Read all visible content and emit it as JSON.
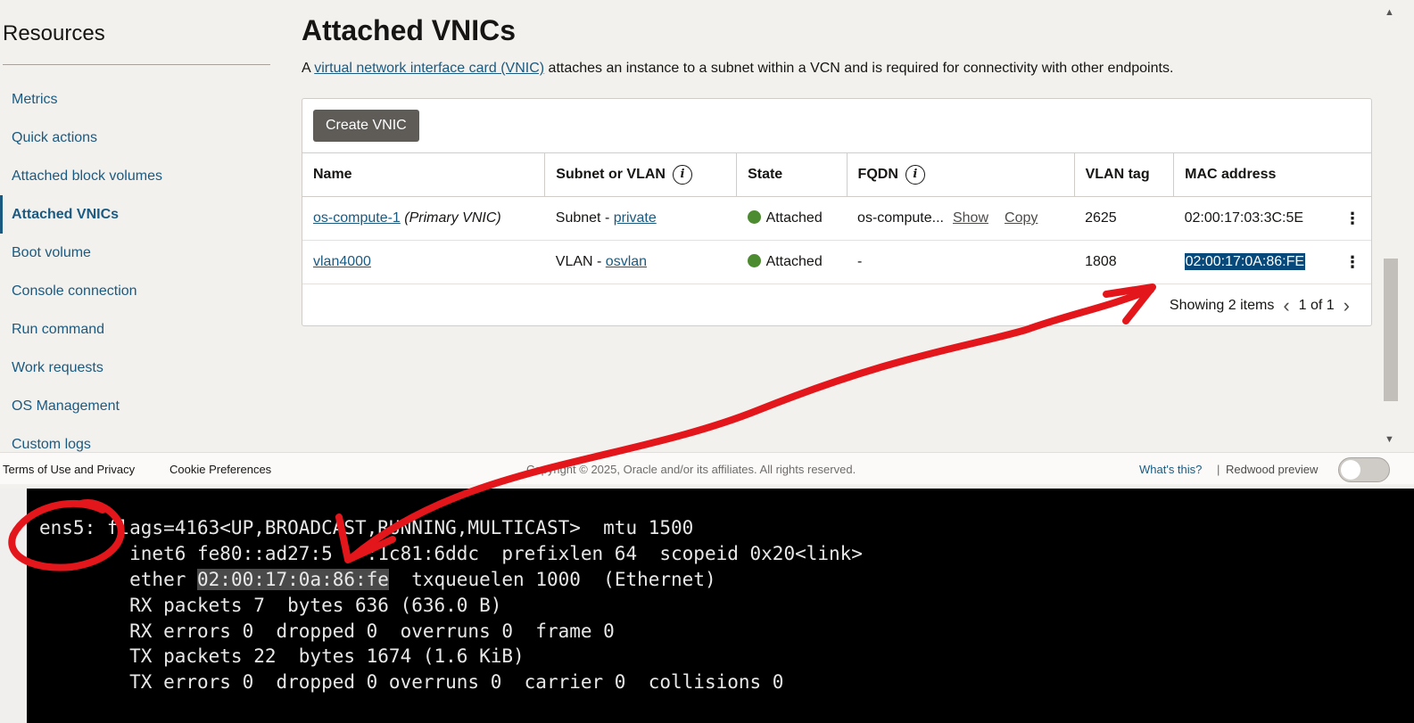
{
  "sidebar": {
    "title": "Resources",
    "items": [
      {
        "label": "Metrics",
        "active": false
      },
      {
        "label": "Quick actions",
        "active": false
      },
      {
        "label": "Attached block volumes",
        "active": false
      },
      {
        "label": "Attached VNICs",
        "active": true
      },
      {
        "label": "Boot volume",
        "active": false
      },
      {
        "label": "Console connection",
        "active": false
      },
      {
        "label": "Run command",
        "active": false
      },
      {
        "label": "Work requests",
        "active": false
      },
      {
        "label": "OS Management",
        "active": false
      },
      {
        "label": "Custom logs",
        "active": false
      }
    ]
  },
  "main": {
    "title": "Attached VNICs",
    "description_prefix": "A ",
    "description_link": "virtual network interface card (VNIC)",
    "description_suffix": " attaches an instance to a subnet within a VCN and is required for connectivity with other endpoints.",
    "create_button": "Create VNIC",
    "table": {
      "headers": [
        "Name",
        "Subnet or VLAN",
        "State",
        "FQDN",
        "VLAN tag",
        "MAC address"
      ],
      "info_icon": "i",
      "rows": [
        {
          "name_link": "os-compute-1",
          "name_suffix": "(Primary VNIC)",
          "subnet_prefix": "Subnet - ",
          "subnet_link": "private",
          "state": "Attached",
          "fqdn": "os-compute...",
          "fqdn_show": "Show",
          "fqdn_copy": "Copy",
          "vlan_tag": "2625",
          "mac": "02:00:17:03:3C:5E",
          "menu": "⋮"
        },
        {
          "name_link": "vlan4000",
          "name_suffix": "",
          "subnet_prefix": "VLAN - ",
          "subnet_link": "osvlan",
          "state": "Attached",
          "fqdn": "-",
          "vlan_tag": "1808",
          "mac": "02:00:17:0A:86:FE",
          "menu": "⋮"
        }
      ]
    },
    "pagination": {
      "showing": "Showing 2 items",
      "page": "1 of 1",
      "prev_icon": "‹",
      "next_icon": "›"
    }
  },
  "footer": {
    "terms": "Terms of Use and Privacy",
    "cookies": "Cookie Preferences",
    "copyright": "Copyright © 2025, Oracle and/or its affiliates. All rights reserved.",
    "whats_this": "What's this?",
    "separator": "|",
    "preview": "Redwood preview"
  },
  "terminal": {
    "lines": [
      "ens5: flags=4163<UP,BROADCAST,RUNNING,MULTICAST>  mtu 1500",
      "        inet6 fe80::ad27:5   :1c81:6ddc  prefixlen 64  scopeid 0x20<link>",
      "        RX packets 7  bytes 636 (636.0 B)",
      "        RX errors 0  dropped 0  overruns 0  frame 0",
      "        TX packets 22  bytes 1674 (1.6 KiB)",
      "        TX errors 0  dropped 0 overruns 0  carrier 0  collisions 0"
    ],
    "ether_prefix": "        ether ",
    "ether_mac": "02:00:17:0a:86:fe",
    "ether_suffix": "  txqueuelen 1000  (Ethernet)"
  },
  "colors": {
    "link": "#1b5a80",
    "attached_status": "#4d8b31",
    "annotation": "#e3161b",
    "selection": "#06497a"
  }
}
